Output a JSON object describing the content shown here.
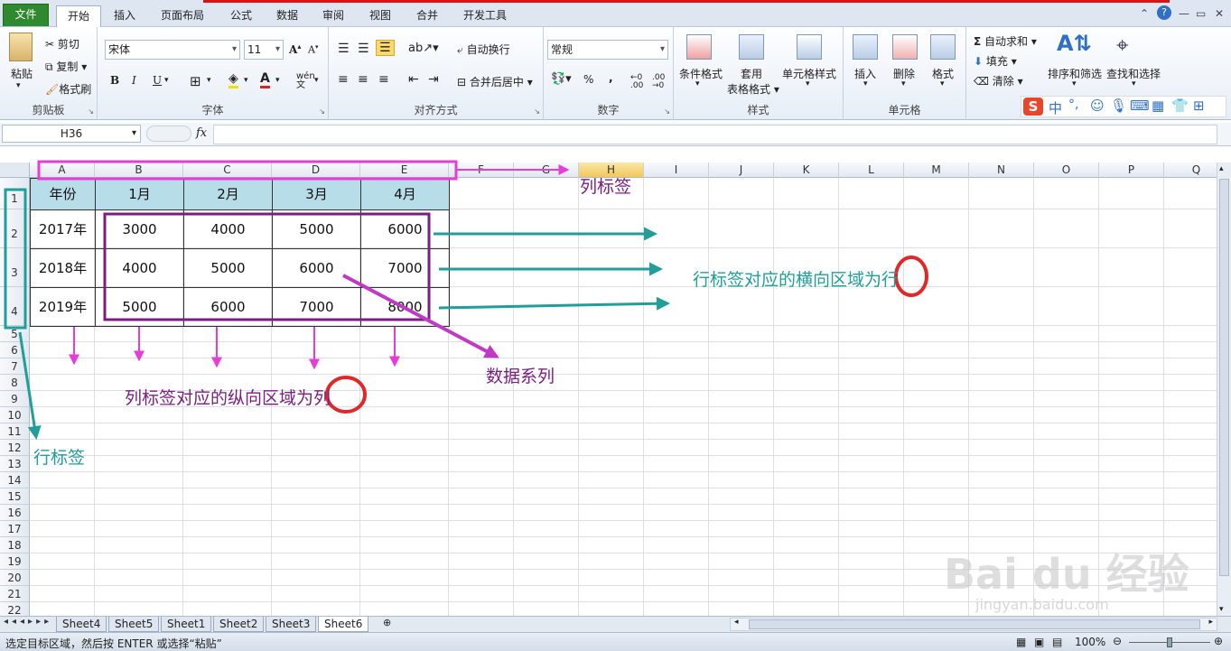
{
  "ribbon_tabs": [
    "文件",
    "开始",
    "插入",
    "页面布局",
    "公式",
    "数据",
    "审阅",
    "视图",
    "合并",
    "开发工具"
  ],
  "clipboard": {
    "paste": "粘贴",
    "cut": "剪切",
    "copy": "复制",
    "format_painter": "格式刷",
    "label": "剪贴板"
  },
  "font": {
    "name": "宋体",
    "size": "11",
    "bold": "B",
    "italic": "I",
    "underline": "U",
    "wen": "wén",
    "label": "字体"
  },
  "align": {
    "wrap": "自动换行",
    "merge": "合并后居中",
    "label": "对齐方式"
  },
  "number": {
    "format": "常规",
    "percent": "%",
    "comma": ",",
    "label": "数字"
  },
  "styles": {
    "cond": "条件格式",
    "table1": "套用",
    "table2": "表格格式",
    "cell": "单元格样式",
    "label": "样式"
  },
  "cells": {
    "insert": "插入",
    "delete": "删除",
    "format": "格式",
    "label": "单元格"
  },
  "editing": {
    "autosum": "自动求和",
    "fill": "填充",
    "clear": "清除",
    "sort": "排序和筛选",
    "find": "查找和选择"
  },
  "ime": {
    "zh": "中"
  },
  "formula": {
    "namebox": "H36",
    "fx": "fx",
    "value": ""
  },
  "columns": [
    "A",
    "B",
    "C",
    "D",
    "E",
    "F",
    "G",
    "H",
    "I",
    "J",
    "K",
    "L",
    "M",
    "N",
    "O",
    "P",
    "Q"
  ],
  "rows": [
    "1",
    "2",
    "3",
    "4",
    "5",
    "6",
    "7",
    "8",
    "9",
    "10",
    "11",
    "12",
    "13",
    "14",
    "15",
    "16",
    "17",
    "18",
    "19",
    "20",
    "21",
    "22"
  ],
  "table": {
    "headers": [
      "年份",
      "1月",
      "2月",
      "3月",
      "4月"
    ],
    "rows": [
      [
        "2017年",
        "3000",
        "4000",
        "5000",
        "6000"
      ],
      [
        "2018年",
        "4000",
        "5000",
        "6000",
        "7000"
      ],
      [
        "2019年",
        "5000",
        "6000",
        "7000",
        "8000"
      ]
    ]
  },
  "annotations": {
    "col_label": "列标签",
    "row_region_a": "行标签对应的横向区域为",
    "row_region_b": "行",
    "data_series": "数据系列",
    "col_region_a": "列标签对应的纵向区域为",
    "col_region_b": "列",
    "row_label": "行标签"
  },
  "sheets": [
    "Sheet4",
    "Sheet5",
    "Sheet1",
    "Sheet2",
    "Sheet3",
    "Sheet6"
  ],
  "active_sheet": "Sheet6",
  "status": {
    "message": "选定目标区域，然后按 ENTER 或选择“粘贴”",
    "zoom": "100%"
  },
  "watermark": {
    "brand": "Bai du 经验",
    "url": "jingyan.baidu.com"
  },
  "colors": {
    "magenta": "#e83cd7",
    "teal": "#1f9e9a",
    "purple": "#7a1f80",
    "red": "#e02828"
  }
}
